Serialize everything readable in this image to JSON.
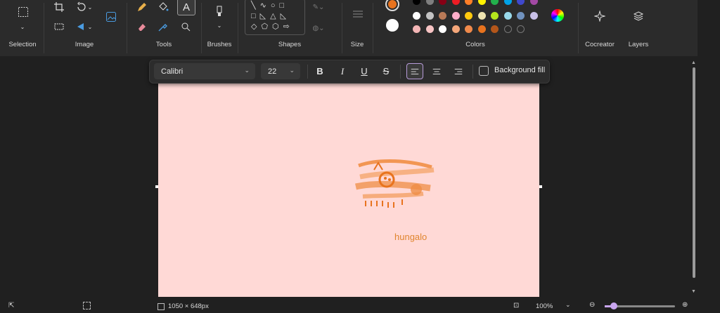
{
  "ribbon": {
    "groups": {
      "selection": "Selection",
      "image": "Image",
      "tools": "Tools",
      "brushes": "Brushes",
      "shapes": "Shapes",
      "size": "Size",
      "colors": "Colors",
      "cocreator": "Cocreator",
      "layers": "Layers"
    },
    "primary_color": "#e8731e",
    "secondary_color": "#ffffff",
    "palette_row1": [
      "#000000",
      "#7f7f7f",
      "#880015",
      "#ed1c24",
      "#ff7f27",
      "#fff200",
      "#22b14c",
      "#00a2e8",
      "#3f48cc",
      "#a349a4"
    ],
    "palette_row2": [
      "#ffffff",
      "#c3c3c3",
      "#b97a57",
      "#ffaec9",
      "#ffc90e",
      "#efe4b0",
      "#b5e61d",
      "#99d9ea",
      "#7092be",
      "#c8bfe7"
    ],
    "palette_row3": [
      "#f4b6b6",
      "#f7c4c4",
      "#ffffff",
      "#f5a77a",
      "#f08a4b",
      "#e8731e",
      "#b3561a",
      "empty",
      "empty"
    ]
  },
  "textbar": {
    "font": "Calibri",
    "size": "22",
    "bold": "B",
    "italic": "I",
    "underline": "U",
    "strike": "S",
    "background_fill": "Background fill"
  },
  "canvas": {
    "background": "#ffd9d6",
    "text": "hungalo",
    "text_color": "#e0852f"
  },
  "status": {
    "dimensions": "1050 × 648px",
    "zoom": "100%"
  }
}
